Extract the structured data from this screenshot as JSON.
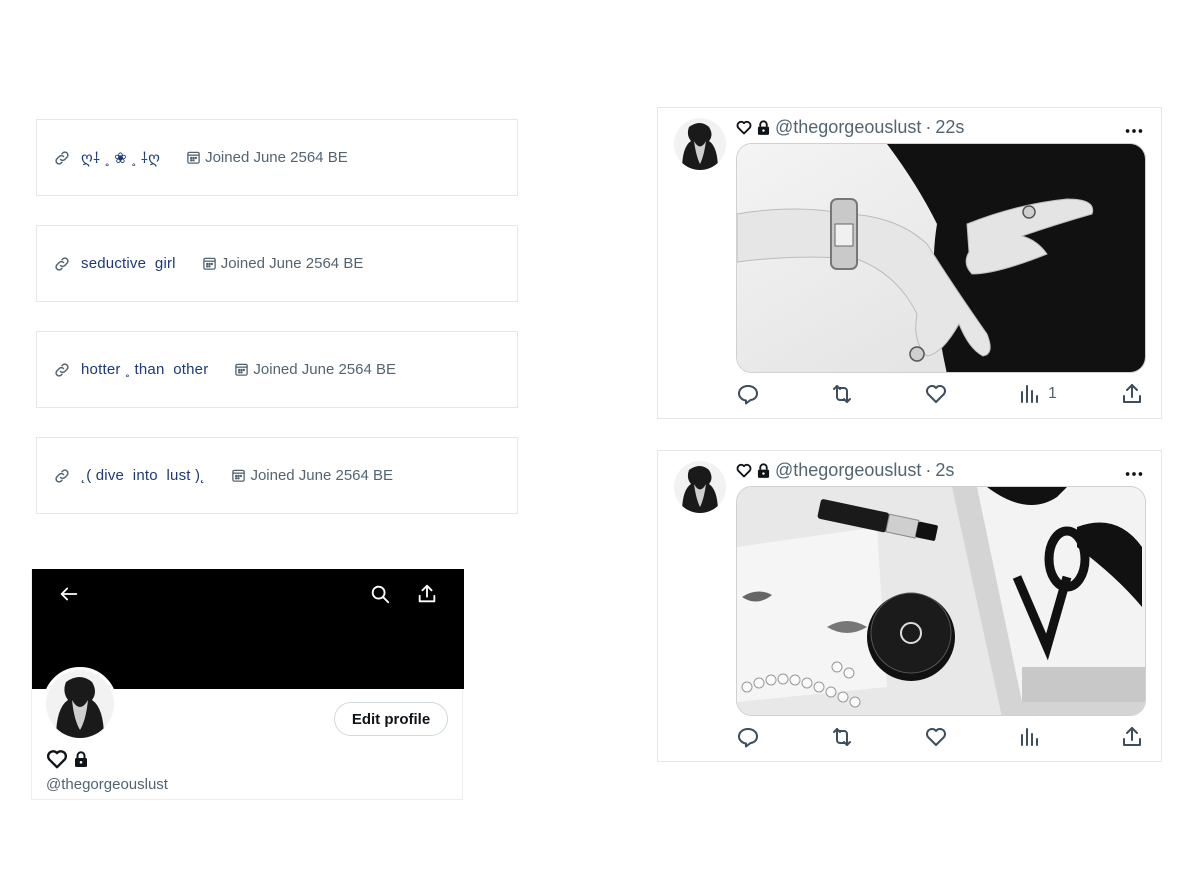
{
  "bio_cards": [
    {
      "link_text": "ღ⸸ ˳ ❀ ˳ ⸸ღ",
      "joined": "Joined June 2564 BE"
    },
    {
      "link_text": "seductive  girl",
      "joined": "Joined June 2564 BE"
    },
    {
      "link_text": "hotter ˳ than  other",
      "joined": "Joined June 2564 BE"
    },
    {
      "link_text": "˛( dive  into  lust )˛",
      "joined": "Joined June 2564 BE"
    }
  ],
  "profile": {
    "edit_label": "Edit profile",
    "handle": "@thegorgeouslust"
  },
  "tweets": [
    {
      "handle": "@thegorgeouslust",
      "separator": "·",
      "time": "22s",
      "views": "1",
      "media": "black-and-white photo of hands with diamond bracelet and rings"
    },
    {
      "handle": "@thegorgeouslust",
      "separator": "·",
      "time": "2s",
      "views": "",
      "media": "black-and-white photo of lipstick, compact, pearls and magazine"
    }
  ],
  "icons": {
    "link": "link-icon",
    "calendar": "calendar-icon",
    "back": "back-arrow-icon",
    "search": "search-icon",
    "share": "share-icon",
    "heart": "heart-icon",
    "lock": "lock-icon",
    "reply": "reply-icon",
    "retweet": "retweet-icon",
    "like": "like-icon",
    "views": "views-icon",
    "more": "more-icon"
  },
  "colors": {
    "link_text": "#1d3a78",
    "muted": "#536471",
    "banner": "#000000"
  }
}
